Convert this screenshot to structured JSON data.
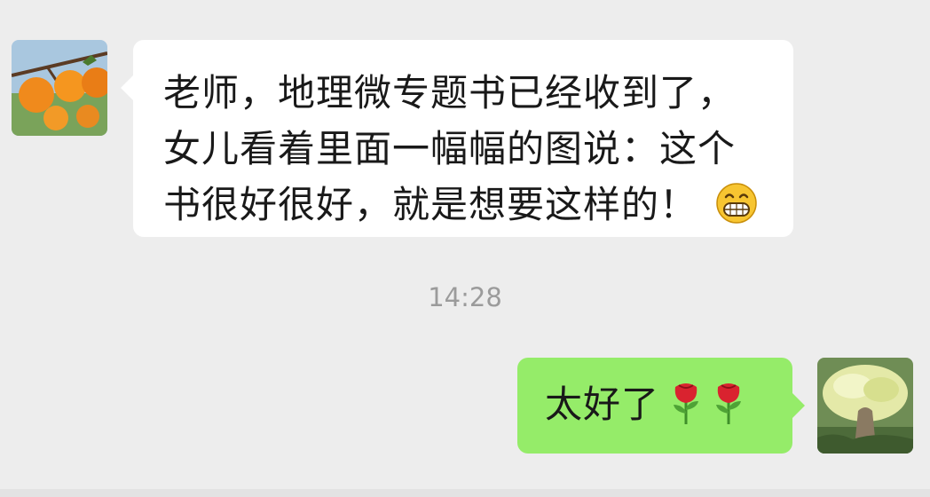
{
  "chat": {
    "incoming": {
      "avatar_icon": "persimmon-avatar-icon",
      "lines": [
        "老师，地理微专题书已经收到了，",
        "女儿看着里面一幅幅的图说：这个",
        "书很好很好，就是想要这样的！"
      ],
      "emoji": "grin-emoji-icon"
    },
    "timestamp": "14:28",
    "outgoing": {
      "avatar_icon": "tree-avatar-icon",
      "text": "太好了",
      "emojis": [
        "rose-emoji-icon",
        "rose-emoji-icon"
      ]
    }
  },
  "colors": {
    "background": "#ededed",
    "incoming_bubble": "#ffffff",
    "outgoing_bubble": "#95ec69",
    "timestamp": "#9b9b9b",
    "text": "#191919"
  }
}
